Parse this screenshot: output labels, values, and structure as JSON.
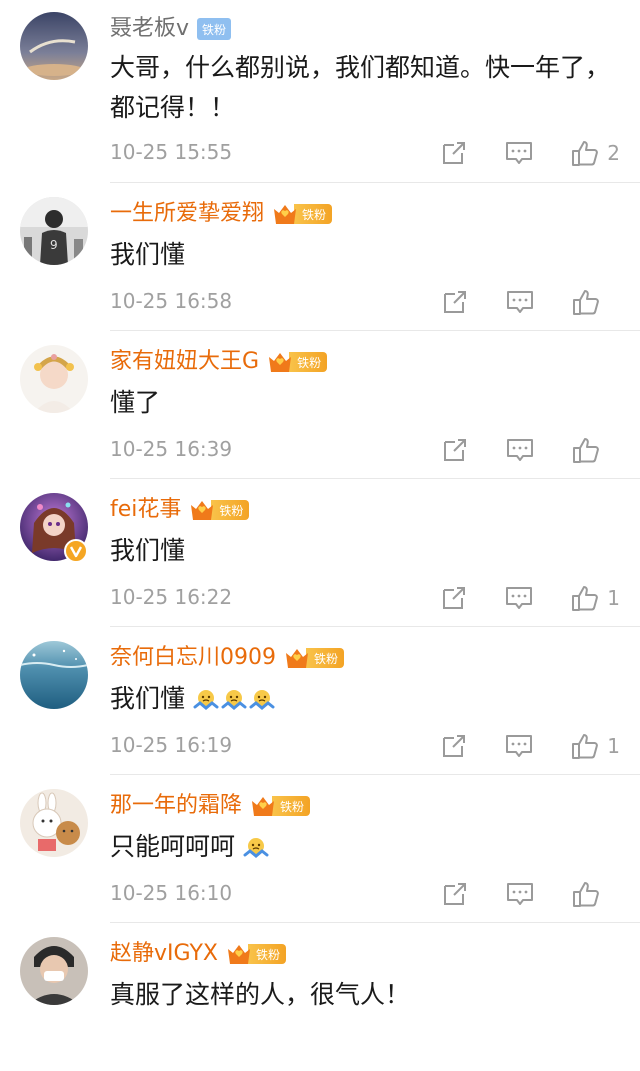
{
  "comments": [
    {
      "username": "聂老板v",
      "badge": "铁粉",
      "text": "大哥，什么都别说，我们都知道。快一年了，都记得！！",
      "time": "10-25 15:55",
      "likes": "2"
    },
    {
      "username": "一生所爱挚爱翔",
      "badge": "铁粉",
      "text": "我们懂",
      "time": "10-25 16:58",
      "likes": ""
    },
    {
      "username": "家有妞妞大王G",
      "badge": "铁粉",
      "text": "懂了",
      "time": "10-25 16:39",
      "likes": ""
    },
    {
      "username": "fei花事",
      "badge": "铁粉",
      "text": "我们懂",
      "time": "10-25 16:22",
      "likes": "1"
    },
    {
      "username": "奈何白忘川0909",
      "badge": "铁粉",
      "text": "我们懂",
      "time": "10-25 16:19",
      "likes": "1"
    },
    {
      "username": "那一年的霜降",
      "badge": "铁粉",
      "text": "只能呵呵呵",
      "time": "10-25 16:10",
      "likes": ""
    },
    {
      "username": "赵静vIGYX",
      "badge": "铁粉",
      "text": "真服了这样的人，很气人！",
      "time": "",
      "likes": ""
    }
  ],
  "icons": {
    "share": "share-icon",
    "comment": "comment-icon",
    "like": "thumbs-up-icon",
    "emoji": "shrug-emoji-icon",
    "verified": "verified-v-icon"
  },
  "colors": {
    "username": "#e86b0a",
    "username_first": "#707070",
    "badge_fan": "#f3a325",
    "badge_plain": "#8fbff0",
    "meta_gray": "#a0a0a0"
  }
}
